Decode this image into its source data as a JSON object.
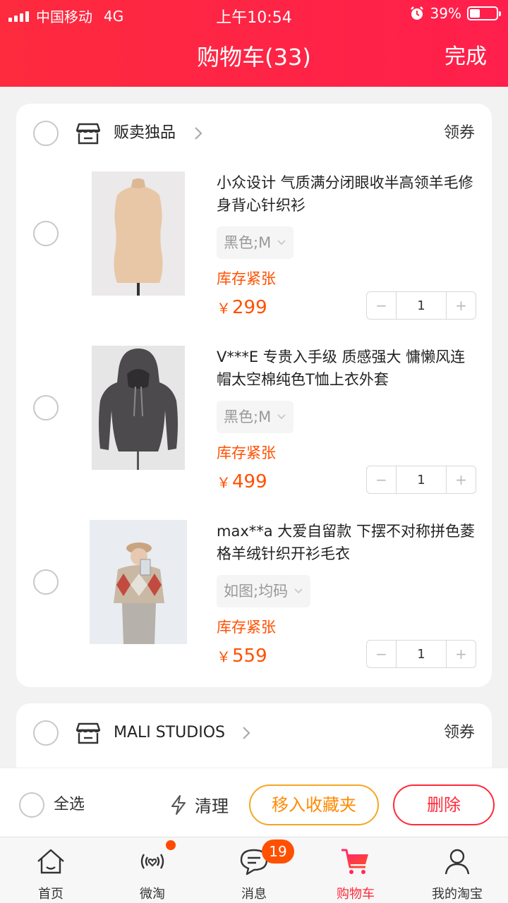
{
  "status_bar": {
    "carrier": "中国移动",
    "network": "4G",
    "time": "上午10:54",
    "battery": "39%"
  },
  "header": {
    "title": "购物车(33)",
    "done": "完成"
  },
  "shops": [
    {
      "name": "贩卖独品",
      "coupon": "领券",
      "items": [
        {
          "title": "小众设计 气质满分闭眼收半高领羊毛修身背心针织衫",
          "spec": "黑色;M",
          "stock": "库存紧张",
          "currency": "￥",
          "price": "299",
          "quantity": "1"
        },
        {
          "title": "V***E 专贵入手级 质感强大 慵懒风连帽太空棉纯色T恤上衣外套",
          "spec": "黑色;M",
          "stock": "库存紧张",
          "currency": "￥",
          "price": "499",
          "quantity": "1"
        },
        {
          "title": "max**a 大爱自留款 下摆不对称拼色菱格羊绒针织开衫毛衣",
          "spec": "如图;均码",
          "stock": "库存紧张",
          "currency": "￥",
          "price": "559",
          "quantity": "1"
        }
      ]
    },
    {
      "name": "MALI STUDIOS",
      "coupon": "领券"
    }
  ],
  "bottom_bar": {
    "select_all": "全选",
    "clean": "清理",
    "move_to_favorites": "移入收藏夹",
    "delete": "删除"
  },
  "tabbar": {
    "tabs": [
      {
        "label": "首页",
        "icon": "home-icon"
      },
      {
        "label": "微淘",
        "icon": "weitao-icon"
      },
      {
        "label": "消息",
        "icon": "message-icon",
        "badge": "19"
      },
      {
        "label": "购物车",
        "icon": "cart-icon"
      },
      {
        "label": "我的淘宝",
        "icon": "profile-icon"
      }
    ],
    "active": "购物车"
  },
  "colors": {
    "brand_red": "#ff2a3a",
    "price_orange": "#ff5000",
    "favorites_orange": "#ff8a00"
  }
}
